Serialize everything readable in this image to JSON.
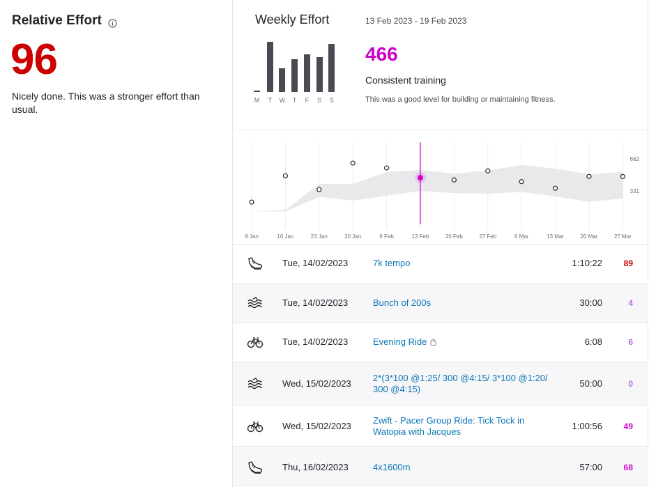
{
  "relative_effort": {
    "title": "Relative Effort",
    "score": "96",
    "description": "Nicely done. This was a stronger effort than usual.",
    "score_color": "#cc0000"
  },
  "weekly": {
    "title": "Weekly Effort",
    "date_range": "13 Feb 2023 - 19 Feb 2023",
    "value": "466",
    "status": "Consistent training",
    "note": "This was a good level for building or maintaining fitness.",
    "value_color": "#cc00cc",
    "days": [
      "M",
      "T",
      "W",
      "T",
      "F",
      "S",
      "S"
    ],
    "day_levels": [
      0.03,
      1.0,
      0.47,
      0.65,
      0.75,
      0.69,
      0.96
    ]
  },
  "chart_data": {
    "type": "line",
    "x": [
      "9 Jan",
      "16 Jan",
      "23 Jan",
      "30 Jan",
      "6 Feb",
      "13 Feb",
      "20 Feb",
      "27 Feb",
      "6 Mar",
      "13 Mar",
      "20 Mar",
      "27 Mar"
    ],
    "series": [
      {
        "values": [
          232,
          475,
          348,
          593,
          548,
          457,
          437,
          521,
          421,
          360,
          469,
          469
        ]
      }
    ],
    "band_low": [
      145,
      145,
      280,
      245,
      290,
      335,
      315,
      310,
      325,
      285,
      235,
      265
    ],
    "band_high": [
      145,
      160,
      400,
      400,
      510,
      530,
      495,
      525,
      575,
      540,
      490,
      510
    ],
    "y_ticks": [
      "662",
      "331"
    ],
    "ylim": [
      0,
      800
    ],
    "highlight": "13 Feb",
    "highlight_color": "#cc00cc",
    "grid": true
  },
  "activities": [
    {
      "icon": "run-shoe-icon",
      "date": "Tue, 14/02/2023",
      "name": "7k tempo",
      "duration": "1:10:22",
      "score": "89",
      "score_color": "#cc0000",
      "locked": false
    },
    {
      "icon": "swim-icon",
      "date": "Tue, 14/02/2023",
      "name": "Bunch of 200s",
      "duration": "30:00",
      "score": "4",
      "score_color": "#b36bdd",
      "locked": false
    },
    {
      "icon": "bike-icon",
      "date": "Tue, 14/02/2023",
      "name": "Evening Ride",
      "duration": "6:08",
      "score": "6",
      "score_color": "#b36bdd",
      "locked": true
    },
    {
      "icon": "swim-icon",
      "date": "Wed, 15/02/2023",
      "name": "2*(3*100 @1:25/ 300 @4:15/ 3*100 @1:20/ 300 @4:15)",
      "duration": "50:00",
      "score": "0",
      "score_color": "#b36bdd",
      "locked": false
    },
    {
      "icon": "bike-icon",
      "date": "Wed, 15/02/2023",
      "name": "Zwift - Pacer Group Ride: Tick Tock in Watopia with Jacques",
      "duration": "1:00:56",
      "score": "49",
      "score_color": "#cc00cc",
      "locked": false
    },
    {
      "icon": "run-shoe-icon",
      "date": "Thu, 16/02/2023",
      "name": "4x1600m",
      "duration": "57:00",
      "score": "68",
      "score_color": "#cc00cc",
      "locked": false
    }
  ]
}
